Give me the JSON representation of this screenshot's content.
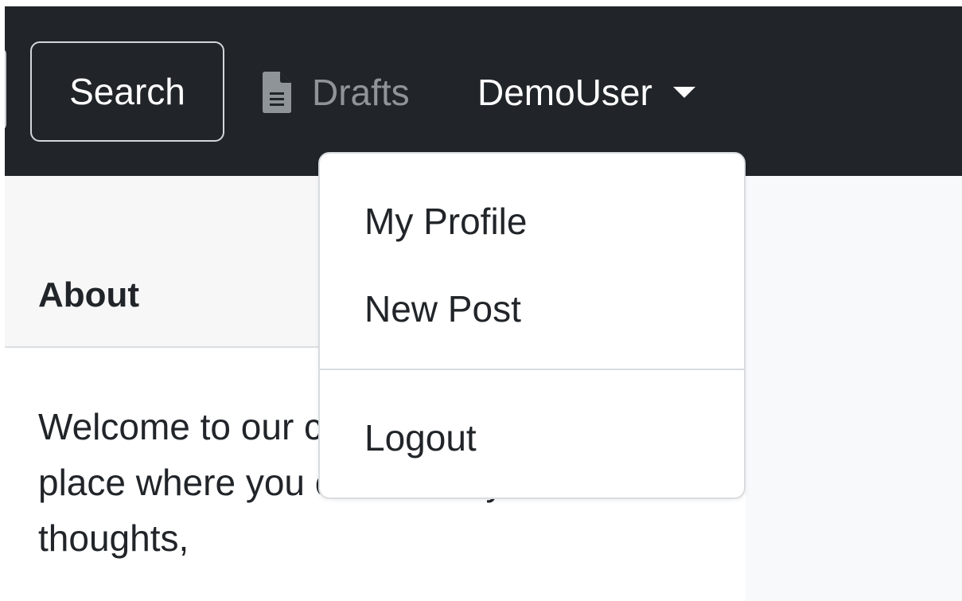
{
  "navbar": {
    "search_label": "Search",
    "drafts_label": "Drafts",
    "drafts_icon": "file-text-icon",
    "user_label": "DemoUser",
    "user_caret_icon": "caret-down-icon",
    "background_color": "#212529"
  },
  "user_menu": {
    "expanded": true,
    "items": [
      {
        "label": "My Profile"
      },
      {
        "label": "New Post"
      },
      {
        "label": "Logout"
      }
    ]
  },
  "about_card": {
    "title": "About",
    "body": "Welcome to our community! This is a place where you can share your thoughts,"
  }
}
